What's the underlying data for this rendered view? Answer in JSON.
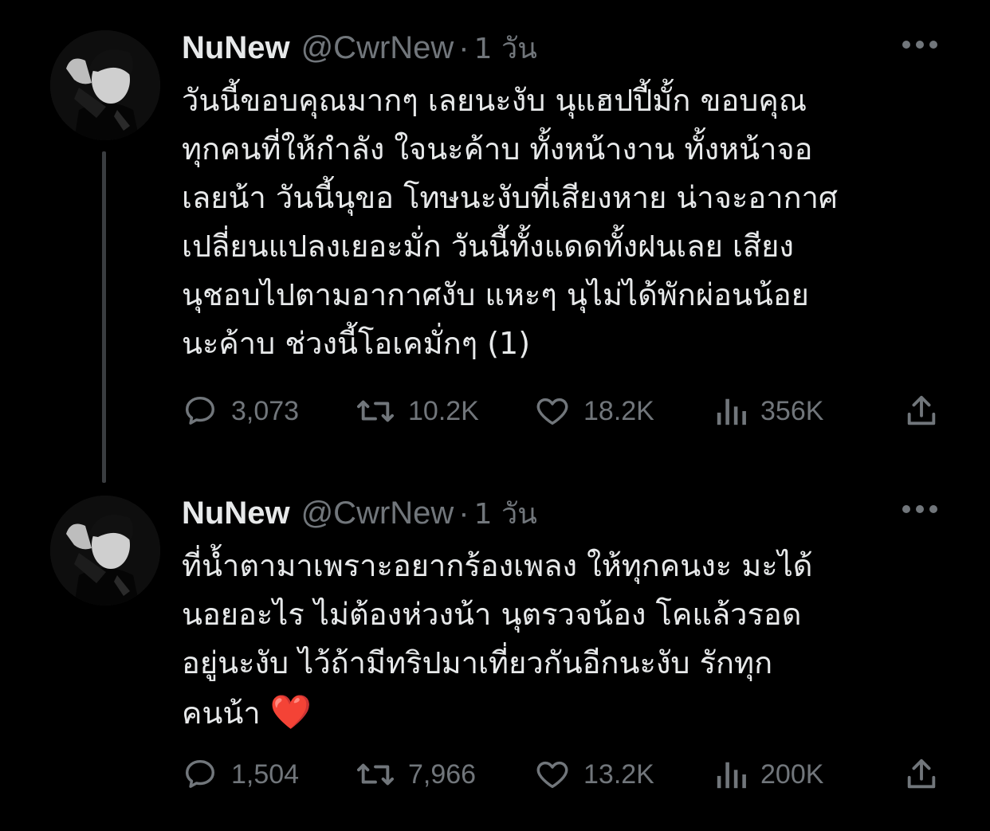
{
  "tweets": [
    {
      "display_name": "NuNew",
      "handle": "@CwrNew",
      "separator": "·",
      "time": "1 วัน",
      "text": "วันนี้ขอบคุณมากๆ เลยนะงับ นุแฮปปี้มั้ก ขอบคุณ\nทุกคนที่ให้กำลัง ใจนะค้าบ ทั้งหน้างาน ทั้งหน้าจอ\nเลยน้า วันนี้นุขอ โทษนะงับที่เสียงหาย น่าจะอากาศ\nเปลี่ยนแปลงเยอะมั่ก วันนี้ทั้งแดดทั้งฝนเลย เสียง\nนุชอบไปตามอากาศงับ แหะๆ นุไม่ได้พักผ่อนน้อย\nนะค้าบ ช่วงนี้โอเคมั่กๆ (1)",
      "emoji": "",
      "stats": {
        "replies": "3,073",
        "retweets": "10.2K",
        "likes": "18.2K",
        "views": "356K"
      }
    },
    {
      "display_name": "NuNew",
      "handle": "@CwrNew",
      "separator": "·",
      "time": "1 วัน",
      "text": "ที่น้ำตามาเพราะอยากร้องเพลง ให้ทุกคนงะ มะได้\nนอยอะไร ไม่ต้องห่วงน้า นุตรวจน้อง โคแล้วรอด\nอยู่นะงับ ไว้ถ้ามีทริปมาเที่ยวกันอีกนะงับ รักทุก\nคนน้า ",
      "emoji": "❤️",
      "stats": {
        "replies": "1,504",
        "retweets": "7,966",
        "likes": "13.2K",
        "views": "200K"
      }
    }
  ],
  "colors": {
    "background": "#000000",
    "text_primary": "#e7e9ea",
    "text_secondary": "#71767b",
    "thread_line": "#3a3d40",
    "heart": "#e0245e"
  },
  "icons": {
    "reply": "speech-bubble-icon",
    "retweet": "retweet-arrows-icon",
    "like": "heart-outline-icon",
    "views": "bar-chart-icon",
    "share": "share-upload-icon",
    "more": "ellipsis-icon"
  }
}
